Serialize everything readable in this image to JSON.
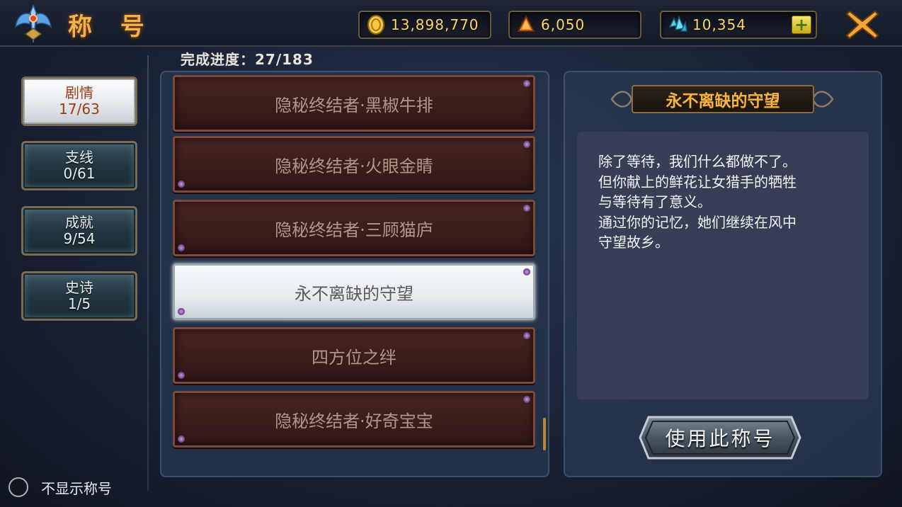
{
  "header": {
    "title": "称 号",
    "gold": "13,898,770",
    "crystal": "6,050",
    "gems": "10,354",
    "plus_label": "+"
  },
  "categories": [
    {
      "label": "剧情",
      "count": "17/63",
      "active": true
    },
    {
      "label": "支线",
      "count": "0/61",
      "active": false
    },
    {
      "label": "成就",
      "count": "9/54",
      "active": false
    },
    {
      "label": "史诗",
      "count": "1/5",
      "active": false
    }
  ],
  "progress": "完成进度：27/183",
  "titles": [
    {
      "name": "隐秘终结者·黑椒牛排",
      "selected": false
    },
    {
      "name": "隐秘终结者·火眼金睛",
      "selected": false
    },
    {
      "name": "隐秘终结者·三顾猫庐",
      "selected": false
    },
    {
      "name": "永不离缺的守望",
      "selected": true
    },
    {
      "name": "四方位之绊",
      "selected": false
    },
    {
      "name": "隐秘终结者·好奇宝宝",
      "selected": false
    }
  ],
  "detail": {
    "title": "永不离缺的守望",
    "description_lines": [
      "除了等待，我们什么都做不了。",
      "但你献上的鲜花让女猎手的牺牲",
      "与等待有了意义。",
      "通过你的记忆，她们继续在风中",
      "守望故乡。"
    ],
    "use_button": "使用此称号"
  },
  "hide_title_label": "不显示称号",
  "colors": {
    "accent_gold": "#f0b347",
    "selected_red": "#a13c12"
  }
}
